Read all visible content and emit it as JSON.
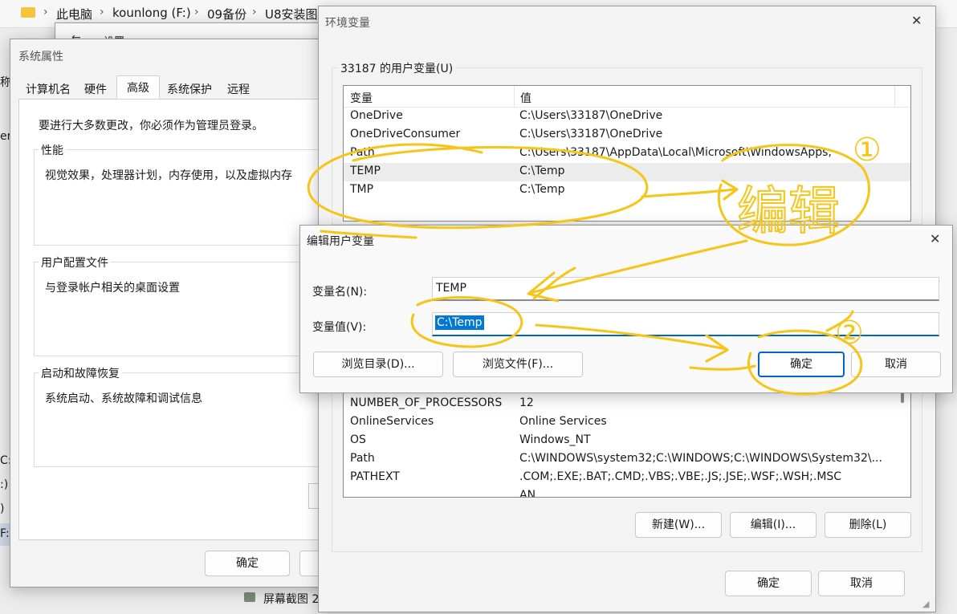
{
  "explorer": {
    "breadcrumb": [
      "此电脑",
      "kounlong (F:)",
      "09备份",
      "U8安装图"
    ],
    "left_fragments": [
      "称",
      "er",
      "C:",
      ":)",
      ")",
      "F:)"
    ],
    "file_item": "屏幕截图 2"
  },
  "settings_title": "设置",
  "sysprops": {
    "title": "系统属性",
    "tabs": [
      "计算机名",
      "硬件",
      "高级",
      "系统保护",
      "远程"
    ],
    "admin_note": "要进行大多数更改，你必须作为管理员登录。",
    "performance": {
      "label": "性能",
      "desc": "视觉效果，处理器计划，内存使用，以及虚拟内存"
    },
    "profiles": {
      "label": "用户配置文件",
      "desc": "与登录帐户相关的桌面设置"
    },
    "startup": {
      "label": "启动和故障恢复",
      "desc": "系统启动、系统故障和调试信息"
    },
    "ok": "确定"
  },
  "envvars": {
    "title": "环境变量",
    "close": "✕",
    "user_group": "33187 的用户变量(U)",
    "col_var": "变量",
    "col_val": "值",
    "user_vars": [
      {
        "name": "OneDrive",
        "value": "C:\\Users\\33187\\OneDrive"
      },
      {
        "name": "OneDriveConsumer",
        "value": "C:\\Users\\33187\\OneDrive"
      },
      {
        "name": "Path",
        "value": "C:\\Users\\33187\\AppData\\Local\\Microsoft\\WindowsApps;"
      },
      {
        "name": "TEMP",
        "value": "C:\\Temp"
      },
      {
        "name": "TMP",
        "value": "C:\\Temp"
      }
    ],
    "system_vars": [
      {
        "name": "NUMBER_OF_PROCESSORS",
        "value": "12"
      },
      {
        "name": "OnlineServices",
        "value": "Online Services"
      },
      {
        "name": "OS",
        "value": "Windows_NT"
      },
      {
        "name": "Path",
        "value": "C:\\WINDOWS\\system32;C:\\WINDOWS;C:\\WINDOWS\\System32\\..."
      },
      {
        "name": "PATHEXT",
        "value": ".COM;.EXE;.BAT;.CMD;.VBS;.VBE;.JS;.JSE;.WSF;.WSH;.MSC"
      },
      {
        "name": "",
        "value": "AN"
      }
    ],
    "new_btn": "新建(W)...",
    "edit_btn": "编辑(I)...",
    "delete_btn": "删除(L)",
    "ok": "确定",
    "cancel": "取消"
  },
  "edit_dialog": {
    "title": "编辑用户变量",
    "close": "✕",
    "name_label": "变量名(N):",
    "name_value": "TEMP",
    "value_label": "变量值(V):",
    "value_value": "C:\\Temp",
    "browse_dir": "浏览目录(D)...",
    "browse_file": "浏览文件(F)...",
    "ok": "确定",
    "cancel": "取消"
  },
  "annotations": {
    "circle1": "①",
    "circle2": "②",
    "note": "编辑",
    "color": "#f5c518"
  }
}
